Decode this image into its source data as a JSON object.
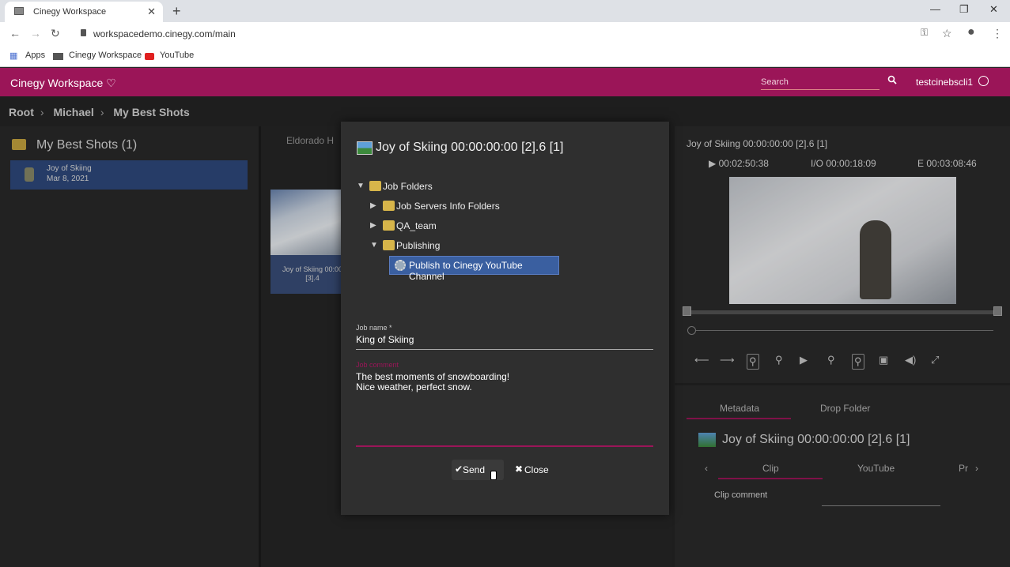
{
  "browser": {
    "tab_title": "Cinegy Workspace",
    "url": "workspacedemo.cinegy.com/main",
    "bookmarks": [
      "Apps",
      "Cinegy Workspace",
      "YouTube"
    ]
  },
  "app": {
    "title": "Cinegy Workspace ♡",
    "search_placeholder": "Search",
    "user": "testcinebscli1"
  },
  "breadcrumb": [
    "Root",
    "Michael",
    "My Best Shots"
  ],
  "left": {
    "title": "My Best Shots (1)",
    "clip": {
      "name": "Joy of Skiing",
      "date": "Mar 8, 2021"
    }
  },
  "middle": {
    "tab": "Eldorado H",
    "thumb_caption": "Joy of Skiing 00:00 [3].4"
  },
  "right": {
    "title": "Joy of Skiing 00:00:00:00 [2].6 [1]",
    "timecode_play": "▶ 00:02:50:38",
    "timecode_io": "I/O 00:00:18:09",
    "timecode_end": "E 00:03:08:46",
    "tabs": [
      "Metadata",
      "Drop Folder"
    ],
    "metadata_title": "Joy of Skiing 00:00:00:00 [2].6 [1]",
    "subtabs": [
      "Clip",
      "YouTube",
      "Pr"
    ],
    "clip_comment_label": "Clip comment"
  },
  "dialog": {
    "title": "Joy of Skiing 00:00:00:00 [2].6 [1]",
    "tree": [
      "Job Folders",
      "Job Servers Info Folders",
      "QA_team",
      "Publishing"
    ],
    "selected_item": "Publish to Cinegy YouTube Channel",
    "job_name_label": "Job name *",
    "job_name_value": "King of Skiing",
    "job_comment_label": "Job comment",
    "job_comment_line1": "The best moments of snowboarding!",
    "job_comment_line2": "Nice weather, perfect snow.",
    "send_label": "Send",
    "close_label": "Close"
  }
}
